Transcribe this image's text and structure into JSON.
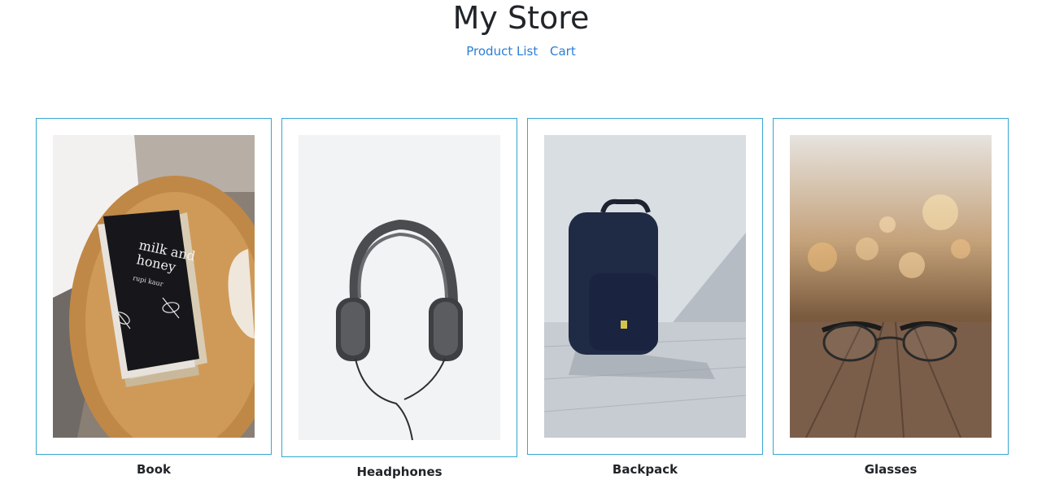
{
  "header": {
    "title": "My Store",
    "nav": [
      {
        "label": "Product List"
      },
      {
        "label": "Cart"
      }
    ]
  },
  "products": [
    {
      "name": "Book",
      "image": "book-photo"
    },
    {
      "name": "Headphones",
      "image": "headphones-photo"
    },
    {
      "name": "Backpack",
      "image": "backpack-photo"
    },
    {
      "name": "Glasses",
      "image": "glasses-photo"
    }
  ],
  "colors": {
    "accent_border": "#37a6cf",
    "link": "#2a7fd4",
    "text": "#212529"
  }
}
